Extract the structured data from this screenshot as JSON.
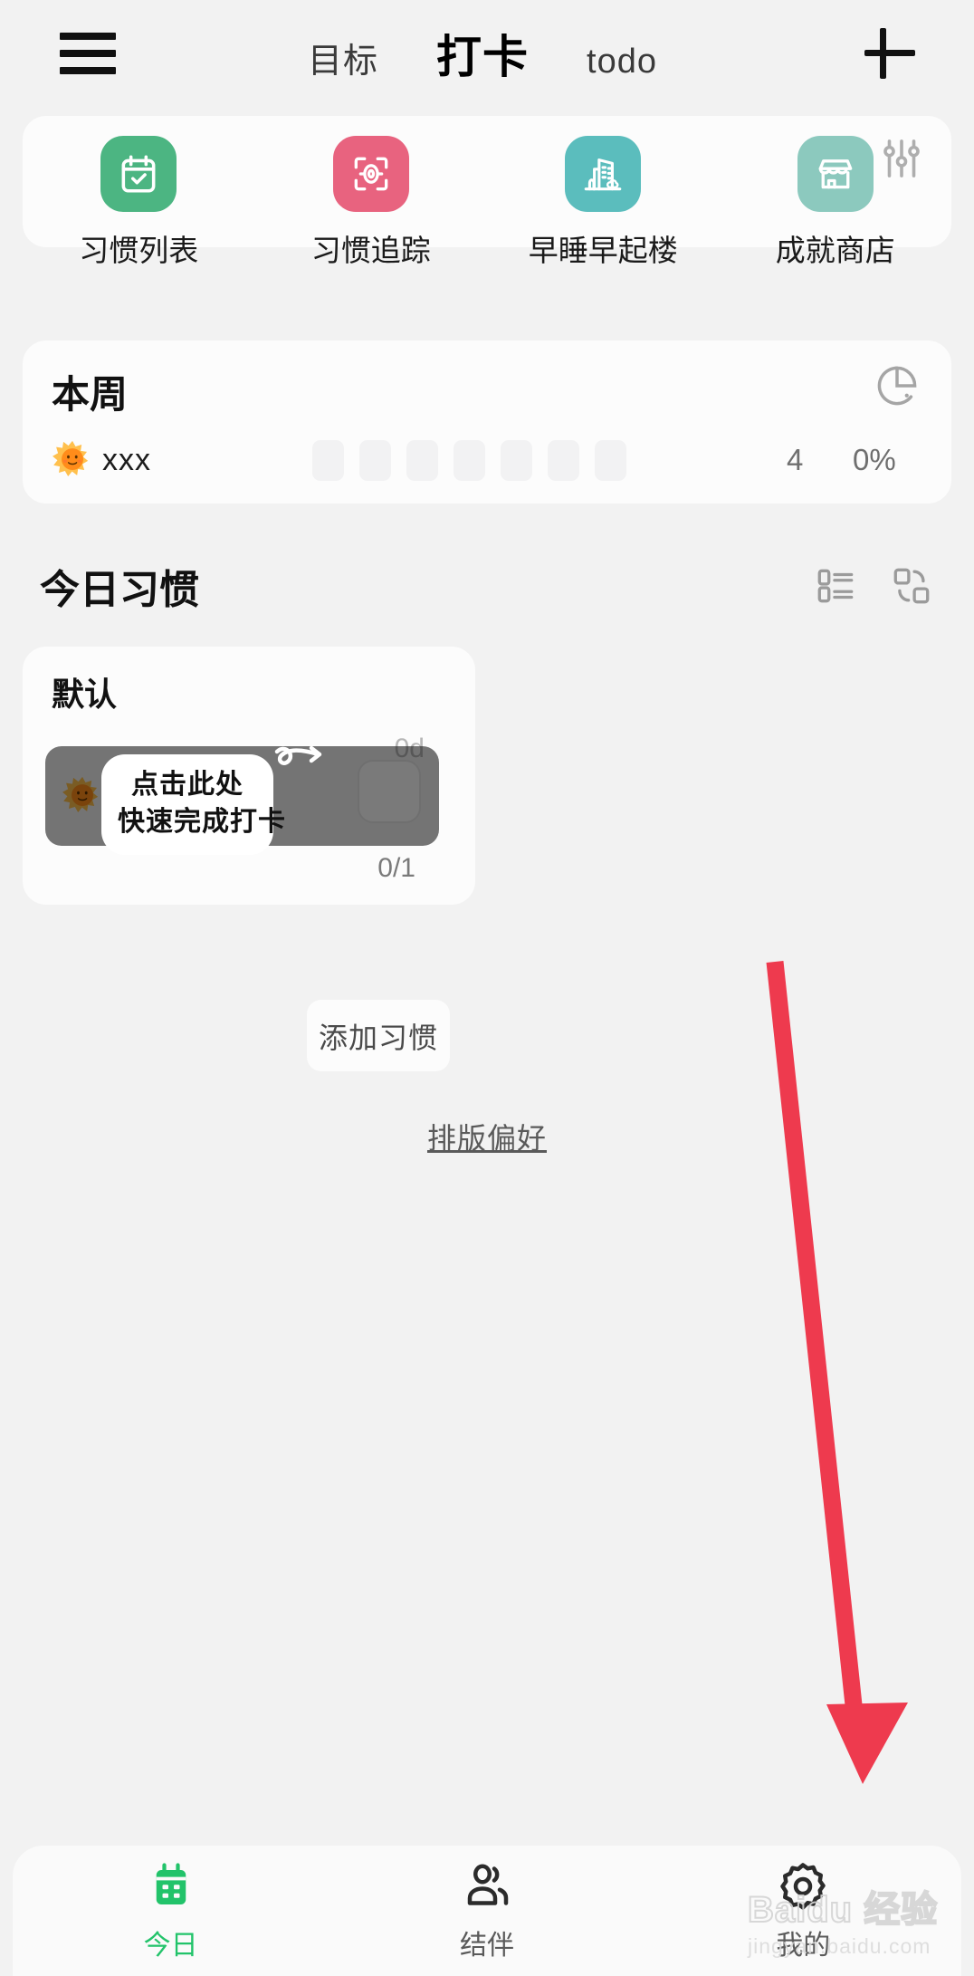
{
  "header": {
    "menu_icon": "hamburger-menu-icon",
    "tabs": [
      {
        "label": "目标",
        "active": false
      },
      {
        "label": "打卡",
        "active": true
      },
      {
        "label": "todo",
        "active": false
      }
    ],
    "add_icon": "plus-icon"
  },
  "shortcuts": {
    "settings_icon": "sliders-settings-icon",
    "items": [
      {
        "label": "习惯列表",
        "icon": "calendar-check-icon",
        "color": "#4CB582"
      },
      {
        "label": "习惯追踪",
        "icon": "target-focus-icon",
        "color": "#E8637F"
      },
      {
        "label": "早睡早起楼",
        "icon": "building-icon",
        "color": "#5BBDBD"
      },
      {
        "label": "成就商店",
        "icon": "store-icon",
        "color": "#8CC9BE"
      }
    ]
  },
  "week": {
    "title": "本周",
    "chart_icon": "pie-chart-icon",
    "habit_emoji": "sun-emoji",
    "habit_name": "xxx",
    "day_cells": [
      "",
      "",
      "",
      "",
      "",
      "",
      ""
    ],
    "count": "4",
    "percent": "0%"
  },
  "today": {
    "title": "今日习惯",
    "list_view_icon": "list-view-icon",
    "layout_swap_icon": "layout-swap-icon",
    "group": {
      "title": "默认",
      "habit": {
        "emoji": "sun-emoji",
        "streak": "0d",
        "progress": "0/1",
        "checkbox": "unchecked-checkbox"
      }
    },
    "tooltip": {
      "line1": "点击此处",
      "line2": "快速完成打卡",
      "arrow_icon": "curved-arrow-icon"
    },
    "add_habit_label": "添加习惯",
    "preference_link": "排版偏好"
  },
  "annotation": {
    "arrow_icon": "red-down-arrow-annotation",
    "color": "#EE3A4E"
  },
  "bottom_nav": {
    "items": [
      {
        "label": "今日",
        "icon": "calendar-icon",
        "active": true
      },
      {
        "label": "结伴",
        "icon": "people-icon",
        "active": false
      },
      {
        "label": "我的",
        "icon": "gear-icon",
        "active": false
      }
    ],
    "active_color": "#22C36A"
  },
  "watermark": {
    "main": "Baidu 经验",
    "sub": "jingyan.baidu.com"
  }
}
